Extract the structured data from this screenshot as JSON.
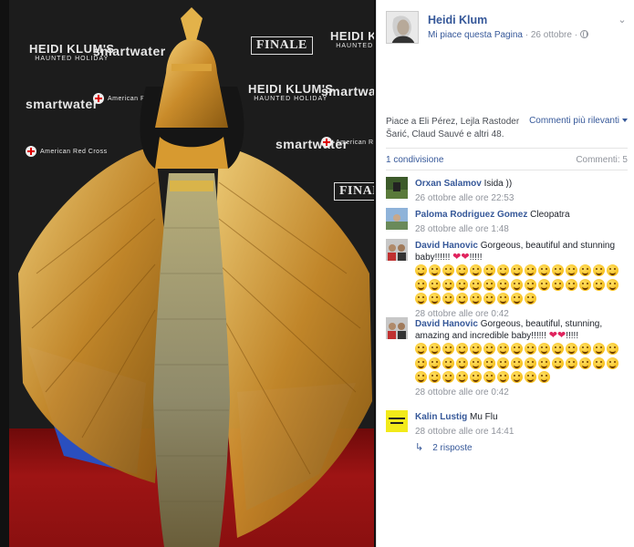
{
  "post": {
    "page_name": "Heidi Klum",
    "like_page_label": "Mi piace questa Pagina",
    "separator": "·",
    "date": "26 ottobre",
    "date_suffix": "·"
  },
  "photo": {
    "backdrop_logos": [
      "HEIDI KLUM'S",
      "HAUNTED HOLIDAY",
      "smartwater",
      "FINALE",
      "American Red Cross"
    ]
  },
  "likes": {
    "text": "Piace a Eli Pérez, Lejla Rastoder Šarić, Claud Sauvé e altri 48.",
    "sort_label": "Commenti più rilevanti"
  },
  "stats": {
    "shares": "1 condivisione",
    "comments": "Commenti: 5"
  },
  "comments": [
    {
      "author": "Orxan Salamov",
      "text": "Isida ))",
      "time": "26 ottobre alle ore 22:53"
    },
    {
      "author": "Paloma Rodriguez Gomez",
      "text": "Cleopatra",
      "time": "28 ottobre alle ore 1:48"
    },
    {
      "author": "David Hanovic",
      "text": "Gorgeous, beautiful and stunning baby!!!!!!",
      "text_tail": "!!!!!",
      "time": "28 ottobre alle ore 0:42",
      "emoji_count": 39
    },
    {
      "author": "David Hanovic",
      "text": "Gorgeous, beautiful, stunning, amazing and incredible baby!!!!!!",
      "text_tail": "!!!!!",
      "time": "28 ottobre alle ore 0:42",
      "emoji_count": 40
    },
    {
      "author": "Kalin Lustig",
      "text": "Mu Flu",
      "time": "28 ottobre alle ore 14:41"
    }
  ],
  "replies": {
    "label": "2 risposte"
  },
  "icons": {
    "globe": "globe-icon",
    "chevron": "chevron-down-icon",
    "reply": "reply-arrow-icon",
    "heart": "heart-icon"
  },
  "colors": {
    "link": "#365899",
    "meta": "#90949c",
    "heart": "#e0245e",
    "emoji": "#f4b400"
  }
}
